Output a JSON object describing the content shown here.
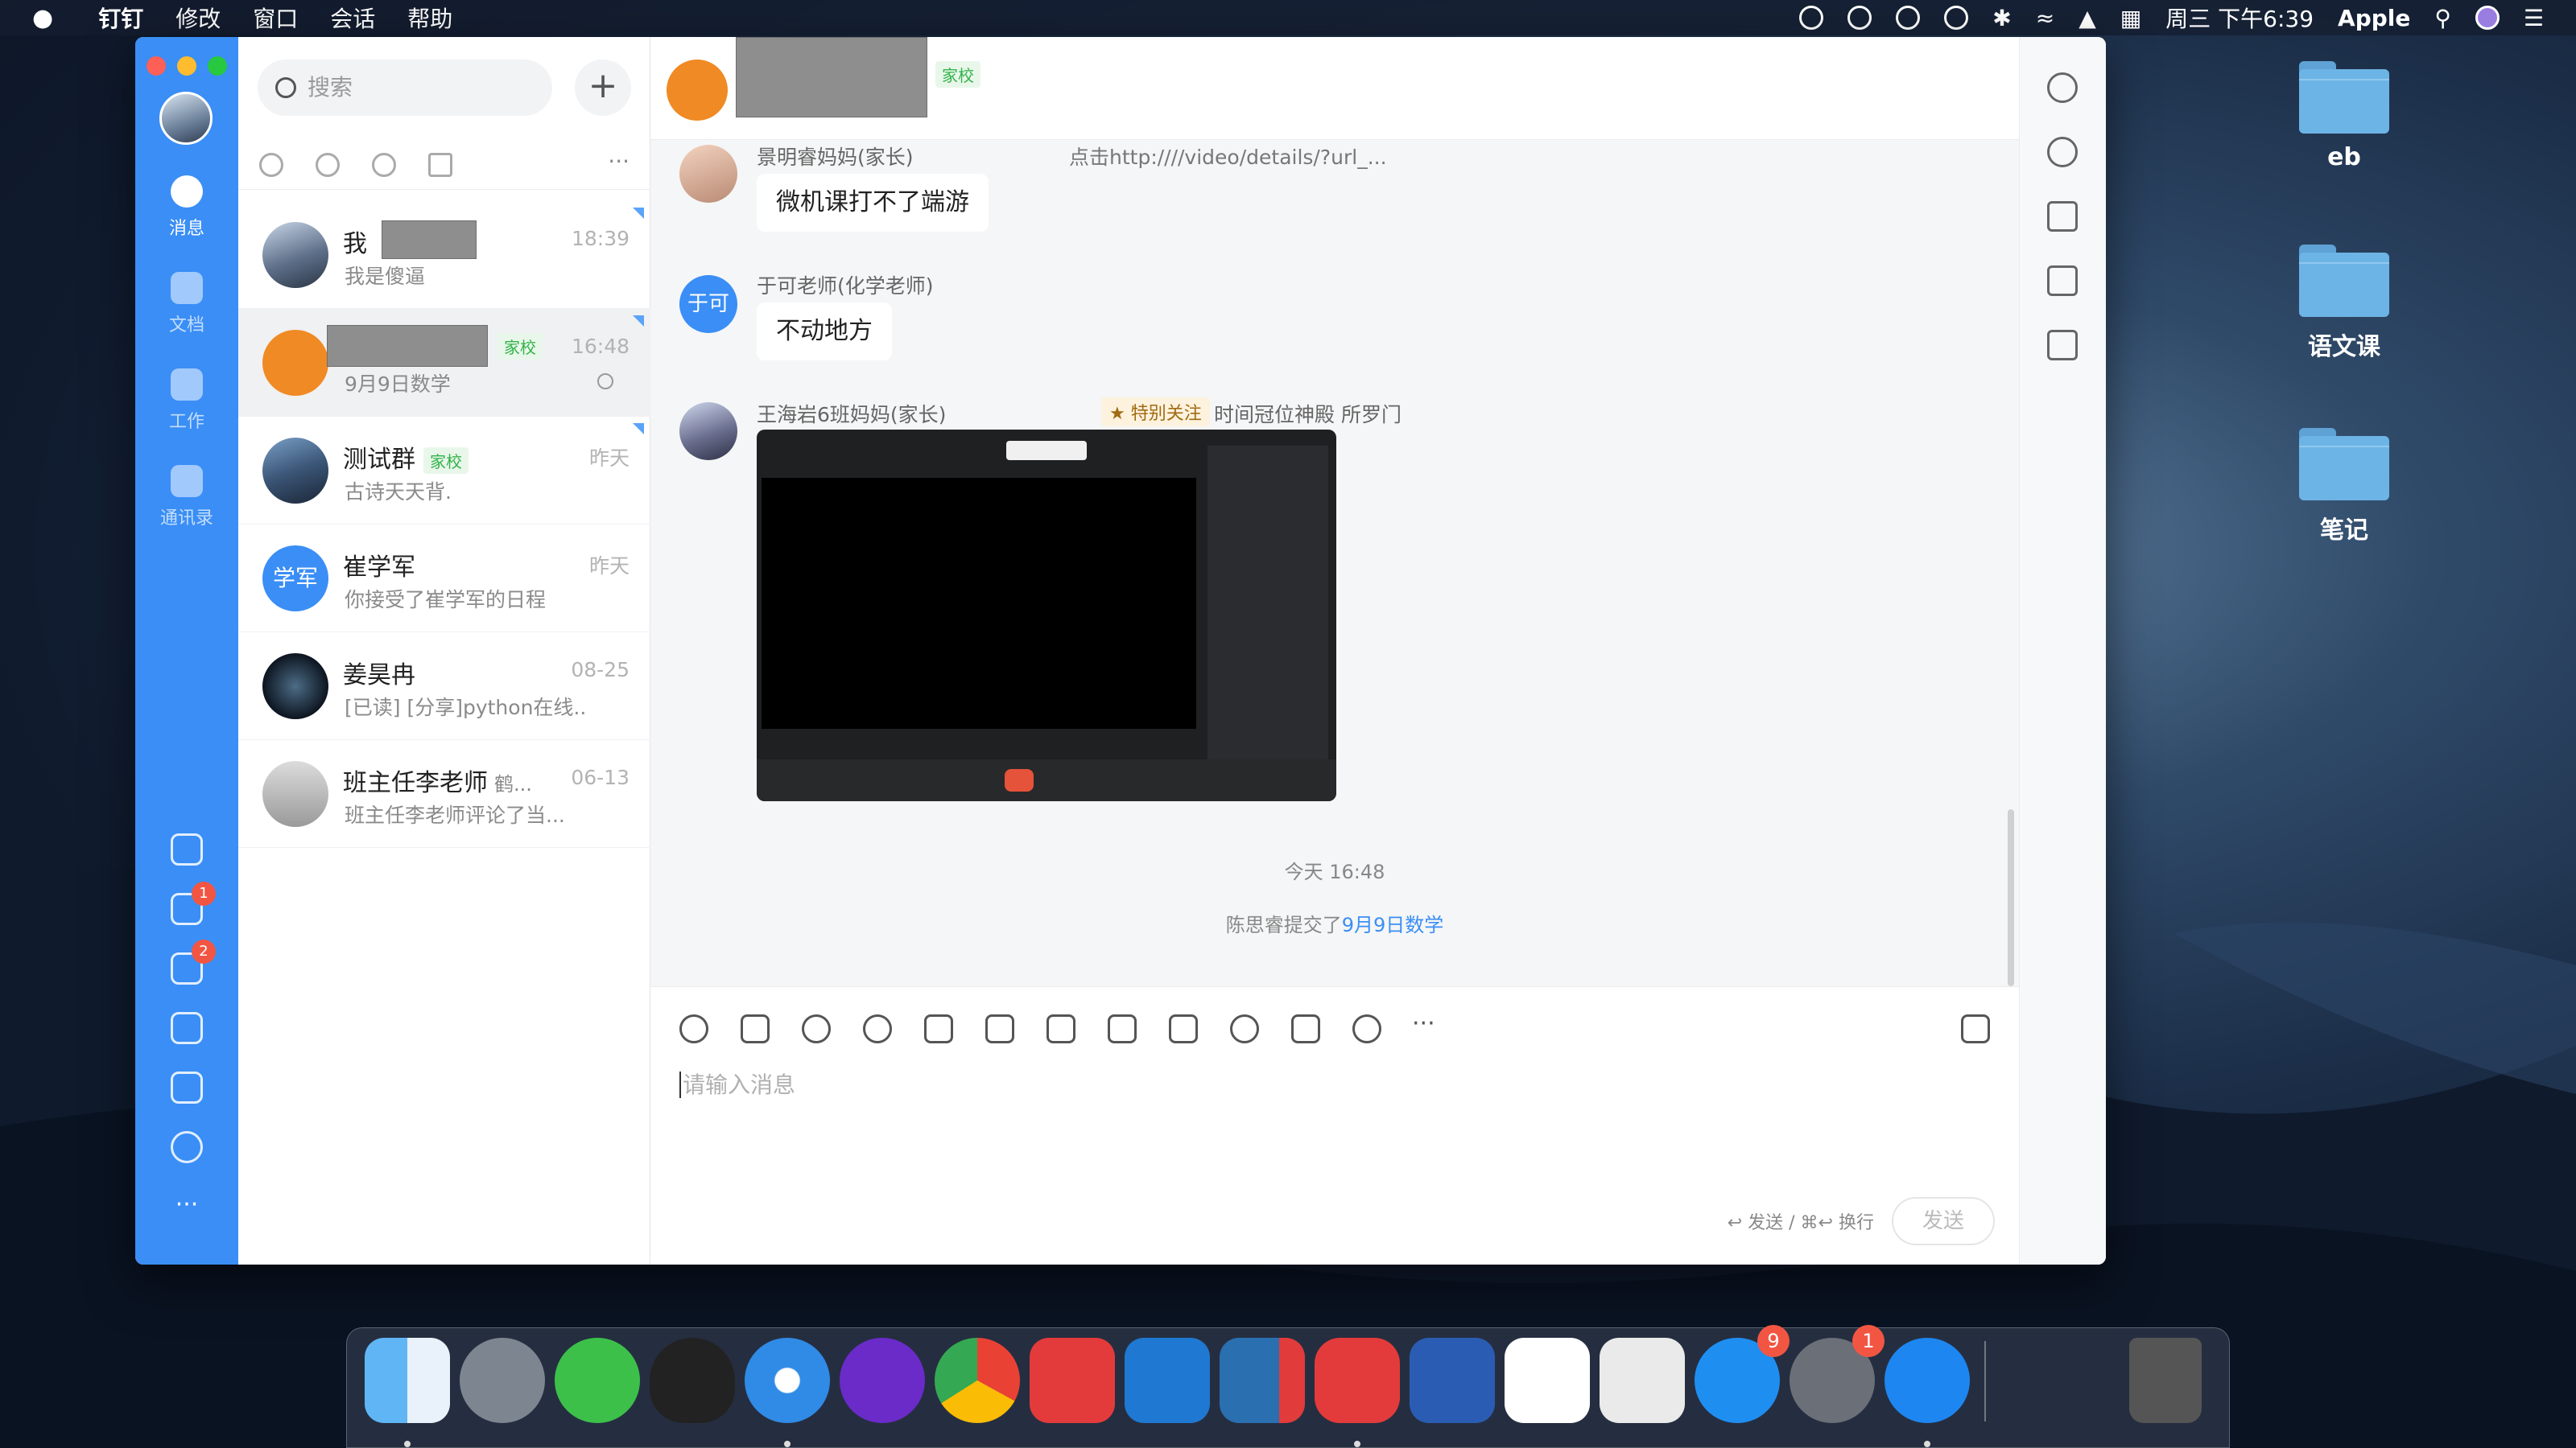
{
  "menubar": {
    "app": "钉钉",
    "menus": [
      "修改",
      "窗口",
      "会话",
      "帮助"
    ],
    "clock": "周三 下午6:39",
    "user": "Apple"
  },
  "desktop": {
    "folders": [
      "eb",
      "语文课",
      "笔记"
    ]
  },
  "rail": {
    "messages": "消息",
    "docs": "文档",
    "work": "工作",
    "contacts": "通讯录",
    "todo_badge": "1",
    "ding_badge": "2",
    "more": "···"
  },
  "list": {
    "search_placeholder": "搜索",
    "add": "+",
    "more": "···",
    "conversations": [
      {
        "name": "我",
        "sub": "我是傻逼",
        "time": "18:39",
        "tag": ""
      },
      {
        "name": "",
        "sub": "9月9日数学",
        "time": "16:48",
        "tag": "家校"
      },
      {
        "name": "测试群",
        "sub": "古诗天天背.",
        "time": "昨天",
        "tag": "家校"
      },
      {
        "name": "崔学军",
        "sub": "你接受了崔学军的日程",
        "time": "昨天",
        "tag": "",
        "avatar_text": "学军"
      },
      {
        "name": "姜昊冉",
        "sub": "[已读] [分享]python在线...",
        "time": "08-25",
        "tag": ""
      },
      {
        "name": "班主任李老师",
        "name_extra": "鹤...",
        "sub": "班主任李老师评论了当...",
        "time": "06-13",
        "tag": ""
      }
    ]
  },
  "chat": {
    "header_tag": "家校",
    "messages": [
      {
        "sender": "景明睿妈妈(家长)",
        "quote": "点击http:////video/details/?url_...",
        "text": "微机课打不了端游"
      },
      {
        "sender": "于可老师(化学老师)",
        "avatar_text": "于可",
        "text": "不动地方"
      },
      {
        "sender": "王海岩6班妈妈(家长)",
        "star": "特别关注",
        "note": "时间冠位神殿 所罗门"
      }
    ],
    "time_divider": "今天 16:48",
    "system_text": "陈思睿提交了",
    "system_link": "9月9日数学",
    "input_placeholder": "请输入消息",
    "send_hint": "↩ 发送 / ⌘↩ 换行",
    "send_label": "发送"
  },
  "dock": {
    "apps": [
      "finder",
      "launchpad",
      "wechat",
      "qq",
      "safari",
      "podcast",
      "chrome",
      "netease-music",
      "vscode",
      "parallels",
      "wps",
      "word",
      "baidu-netdisk",
      "screenshot",
      "app-store",
      "system-preferences",
      "dingtalk",
      "trash"
    ],
    "appstore_badge": "9",
    "prefs_badge": "1"
  }
}
